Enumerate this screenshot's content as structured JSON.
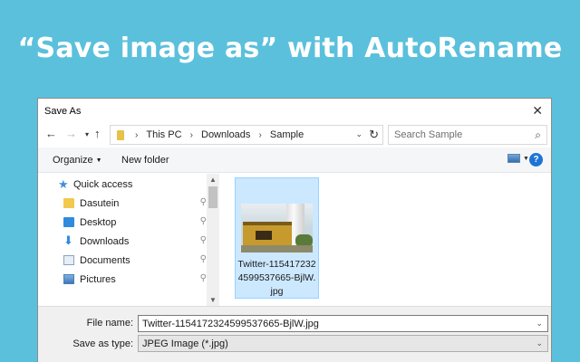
{
  "headline": "“Save image as” with AutoRename",
  "dialog": {
    "title": "Save As",
    "address": {
      "crumbs": [
        "This PC",
        "Downloads",
        "Sample"
      ]
    },
    "search": {
      "placeholder": "Search Sample"
    },
    "toolbar": {
      "organize_label": "Organize",
      "new_folder_label": "New folder",
      "help_label": "?"
    },
    "nav": {
      "items": [
        {
          "label": "Quick access",
          "icon": "star-icon"
        },
        {
          "label": "Dasutein",
          "icon": "folder-icon",
          "pinned": true
        },
        {
          "label": "Desktop",
          "icon": "desktop-icon",
          "pinned": true
        },
        {
          "label": "Downloads",
          "icon": "download-icon",
          "pinned": true
        },
        {
          "label": "Documents",
          "icon": "documents-icon",
          "pinned": true
        },
        {
          "label": "Pictures",
          "icon": "pictures-icon",
          "pinned": true
        }
      ]
    },
    "files": [
      {
        "name": "Twitter-1154172324599537665-BjlW.jpg",
        "selected": true
      }
    ],
    "form": {
      "file_name_label": "File name:",
      "file_name_value": "Twitter-1154172324599537665-BjlW.jpg",
      "save_type_label": "Save as type:",
      "save_type_value": "JPEG Image (*.jpg)"
    }
  },
  "colors": {
    "background": "#5bc0dc",
    "selection": "#cce8ff",
    "accent": "#1e73d6"
  }
}
